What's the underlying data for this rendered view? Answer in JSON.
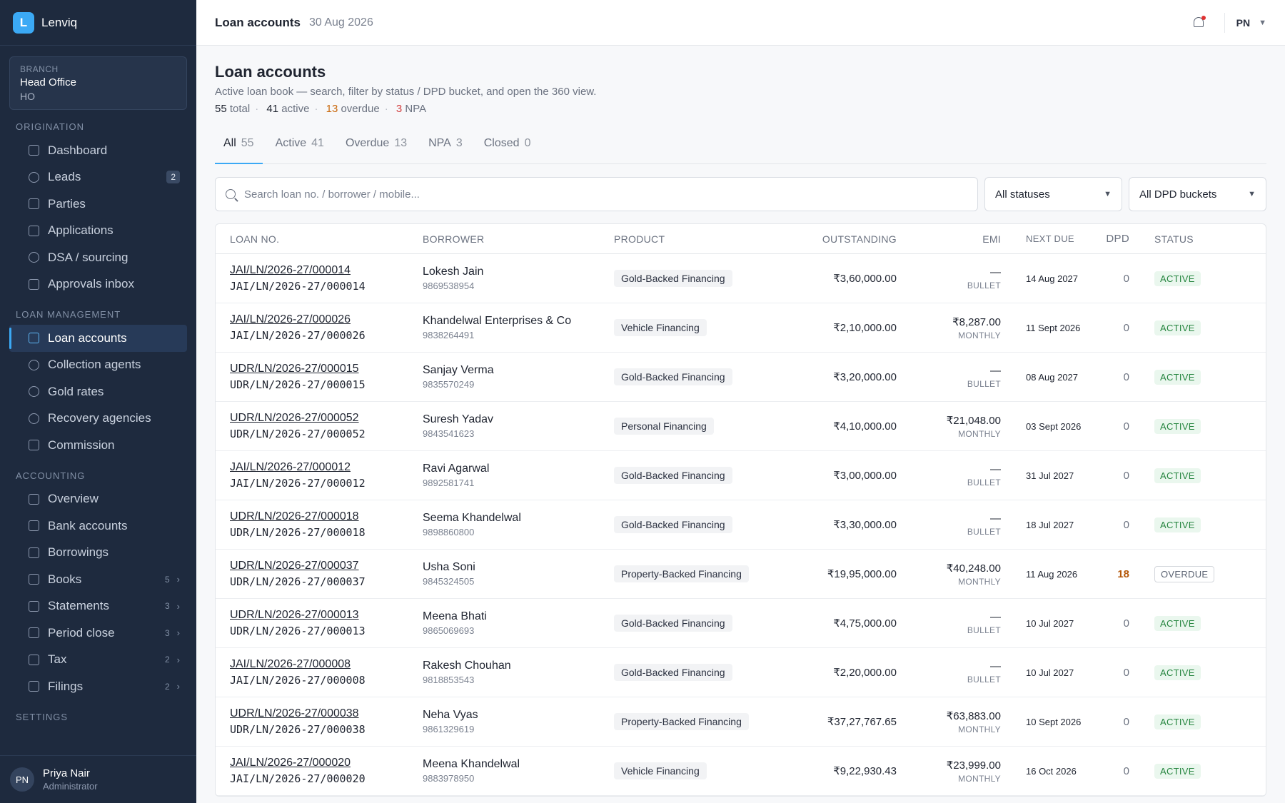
{
  "app": {
    "brand_letter": "L",
    "brand_name": "Lenviq"
  },
  "branch": {
    "label": "BRANCH",
    "name": "Head Office",
    "code": "HO"
  },
  "sidebar": {
    "sections": [
      {
        "title": "ORIGINATION",
        "items": [
          {
            "label": "Dashboard",
            "icon": "grid-icon"
          },
          {
            "label": "Leads",
            "icon": "users-icon",
            "badge": "2"
          },
          {
            "label": "Parties",
            "icon": "id-card-icon"
          },
          {
            "label": "Applications",
            "icon": "file-icon"
          },
          {
            "label": "DSA / sourcing",
            "icon": "users-icon"
          },
          {
            "label": "Approvals inbox",
            "icon": "inbox-icon"
          }
        ]
      },
      {
        "title": "LOAN MANAGEMENT",
        "items": [
          {
            "label": "Loan accounts",
            "icon": "bank-icon",
            "active": true
          },
          {
            "label": "Collection agents",
            "icon": "users-icon"
          },
          {
            "label": "Gold rates",
            "icon": "coins-icon"
          },
          {
            "label": "Recovery agencies",
            "icon": "coins-icon"
          },
          {
            "label": "Commission",
            "icon": "file-icon"
          }
        ]
      },
      {
        "title": "ACCOUNTING",
        "items": [
          {
            "label": "Overview",
            "icon": "file-icon"
          },
          {
            "label": "Bank accounts",
            "icon": "file-icon"
          },
          {
            "label": "Borrowings",
            "icon": "file-icon"
          },
          {
            "label": "Books",
            "icon": "file-icon",
            "count": "5"
          },
          {
            "label": "Statements",
            "icon": "file-icon",
            "count": "3"
          },
          {
            "label": "Period close",
            "icon": "file-icon",
            "count": "3"
          },
          {
            "label": "Tax",
            "icon": "file-icon",
            "count": "2"
          },
          {
            "label": "Filings",
            "icon": "clipboard-icon",
            "count": "2"
          }
        ]
      },
      {
        "title": "SETTINGS",
        "items": []
      }
    ]
  },
  "user": {
    "initials": "PN",
    "name": "Priya Nair",
    "role": "Administrator"
  },
  "topbar": {
    "title": "Loan accounts",
    "date": "30 Aug 2026",
    "initials": "PN"
  },
  "page": {
    "title": "Loan accounts",
    "subtitle": "Active loan book — search, filter by status / DPD bucket, and open the 360 view.",
    "stats": {
      "total": "55",
      "total_label": "total",
      "active": "41",
      "active_label": "active",
      "overdue": "13",
      "overdue_label": "overdue",
      "npa": "3",
      "npa_label": "NPA"
    }
  },
  "tabs": [
    {
      "label": "All",
      "count": "55",
      "active": true
    },
    {
      "label": "Active",
      "count": "41"
    },
    {
      "label": "Overdue",
      "count": "13"
    },
    {
      "label": "NPA",
      "count": "3"
    },
    {
      "label": "Closed",
      "count": "0"
    }
  ],
  "search": {
    "placeholder": "Search loan no. / borrower / mobile..."
  },
  "filters": {
    "status": "All statuses",
    "dpd": "All DPD buckets"
  },
  "table": {
    "headers": [
      "LOAN NO.",
      "BORROWER",
      "PRODUCT",
      "OUTSTANDING",
      "EMI",
      "NEXT DUE",
      "DPD",
      "STATUS"
    ],
    "rows": [
      {
        "loan": "JAI/LN/2026-27/000014",
        "borrower": "Lokesh Jain",
        "mobile": "9869538954",
        "product": "Gold-Backed Financing",
        "outstanding": "₹3,60,000.00",
        "emi": "—",
        "emi_type": "BULLET",
        "next_due": "14 Aug 2027",
        "dpd": "0",
        "status": "ACTIVE"
      },
      {
        "loan": "JAI/LN/2026-27/000026",
        "borrower": "Khandelwal Enterprises & Co",
        "mobile": "9838264491",
        "product": "Vehicle Financing",
        "outstanding": "₹2,10,000.00",
        "emi": "₹8,287.00",
        "emi_type": "MONTHLY",
        "next_due": "11 Sept 2026",
        "dpd": "0",
        "status": "ACTIVE"
      },
      {
        "loan": "UDR/LN/2026-27/000015",
        "borrower": "Sanjay Verma",
        "mobile": "9835570249",
        "product": "Gold-Backed Financing",
        "outstanding": "₹3,20,000.00",
        "emi": "—",
        "emi_type": "BULLET",
        "next_due": "08 Aug 2027",
        "dpd": "0",
        "status": "ACTIVE"
      },
      {
        "loan": "UDR/LN/2026-27/000052",
        "borrower": "Suresh Yadav",
        "mobile": "9843541623",
        "product": "Personal Financing",
        "outstanding": "₹4,10,000.00",
        "emi": "₹21,048.00",
        "emi_type": "MONTHLY",
        "next_due": "03 Sept 2026",
        "dpd": "0",
        "status": "ACTIVE"
      },
      {
        "loan": "JAI/LN/2026-27/000012",
        "borrower": "Ravi Agarwal",
        "mobile": "9892581741",
        "product": "Gold-Backed Financing",
        "outstanding": "₹3,00,000.00",
        "emi": "—",
        "emi_type": "BULLET",
        "next_due": "31 Jul 2027",
        "dpd": "0",
        "status": "ACTIVE"
      },
      {
        "loan": "UDR/LN/2026-27/000018",
        "borrower": "Seema Khandelwal",
        "mobile": "9898860800",
        "product": "Gold-Backed Financing",
        "outstanding": "₹3,30,000.00",
        "emi": "—",
        "emi_type": "BULLET",
        "next_due": "18 Jul 2027",
        "dpd": "0",
        "status": "ACTIVE"
      },
      {
        "loan": "UDR/LN/2026-27/000037",
        "borrower": "Usha Soni",
        "mobile": "9845324505",
        "product": "Property-Backed Financing",
        "outstanding": "₹19,95,000.00",
        "emi": "₹40,248.00",
        "emi_type": "MONTHLY",
        "next_due": "11 Aug 2026",
        "dpd": "18",
        "status": "OVERDUE"
      },
      {
        "loan": "UDR/LN/2026-27/000013",
        "borrower": "Meena Bhati",
        "mobile": "9865069693",
        "product": "Gold-Backed Financing",
        "outstanding": "₹4,75,000.00",
        "emi": "—",
        "emi_type": "BULLET",
        "next_due": "10 Jul 2027",
        "dpd": "0",
        "status": "ACTIVE"
      },
      {
        "loan": "JAI/LN/2026-27/000008",
        "borrower": "Rakesh Chouhan",
        "mobile": "9818853543",
        "product": "Gold-Backed Financing",
        "outstanding": "₹2,20,000.00",
        "emi": "—",
        "emi_type": "BULLET",
        "next_due": "10 Jul 2027",
        "dpd": "0",
        "status": "ACTIVE"
      },
      {
        "loan": "UDR/LN/2026-27/000038",
        "borrower": "Neha Vyas",
        "mobile": "9861329619",
        "product": "Property-Backed Financing",
        "outstanding": "₹37,27,767.65",
        "emi": "₹63,883.00",
        "emi_type": "MONTHLY",
        "next_due": "10 Sept 2026",
        "dpd": "0",
        "status": "ACTIVE"
      },
      {
        "loan": "JAI/LN/2026-27/000020",
        "borrower": "Meena Khandelwal",
        "mobile": "9883978950",
        "product": "Vehicle Financing",
        "outstanding": "₹9,22,930.43",
        "emi": "₹23,999.00",
        "emi_type": "MONTHLY",
        "next_due": "16 Oct 2026",
        "dpd": "0",
        "status": "ACTIVE"
      }
    ]
  }
}
